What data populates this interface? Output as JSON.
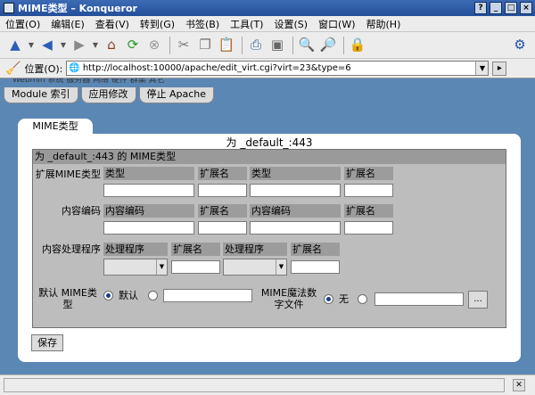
{
  "window": {
    "title": "MIME类型 – Konqueror",
    "buttons": [
      "?",
      "_",
      "□",
      "×"
    ]
  },
  "menu": [
    "位置(O)",
    "编辑(E)",
    "查看(V)",
    "转到(G)",
    "书签(B)",
    "工具(T)",
    "设置(S)",
    "窗口(W)",
    "帮助(H)"
  ],
  "toolbar": {
    "icons": [
      "up-arrow-icon",
      "back-arrow-icon",
      "forward-arrow-icon",
      "home-icon",
      "reload-icon",
      "stop-icon",
      "cut-icon",
      "copy-icon",
      "paste-icon",
      "print-icon",
      "new-window-icon",
      "zoom-in-icon",
      "zoom-out-icon",
      "lock-icon",
      "settings-icon"
    ]
  },
  "location": {
    "label": "位置(O):",
    "url": "http://localhost:10000/apache/edit_virt.cgi?virt=23&type=6"
  },
  "nav": {
    "strip_text": "Webmin  系统  服务器  网络  硬件  群集  其它",
    "tabs": [
      "Module 索引",
      "应用修改",
      "停止 Apache"
    ]
  },
  "page": {
    "tab": "MIME类型",
    "heading": "为 _default_:443",
    "box_title": "为 _default_:443 的 MIME类型",
    "ext_mime": {
      "label": "扩展MIME类型",
      "columns": [
        "类型",
        "扩展名",
        "类型",
        "扩展名"
      ]
    },
    "encoding": {
      "label": "内容编码",
      "columns": [
        "内容编码",
        "扩展名",
        "内容编码",
        "扩展名"
      ]
    },
    "handler": {
      "label": "内容处理程序",
      "columns": [
        "处理程序",
        "扩展名",
        "处理程序",
        "扩展名"
      ]
    },
    "default_mime": {
      "label": "默认 MIME类型",
      "option_default": "默认",
      "value": ""
    },
    "magic": {
      "label": "MIME魔法数字文件",
      "option_none": "无",
      "value": "",
      "browse": "..."
    },
    "save": "保存"
  }
}
